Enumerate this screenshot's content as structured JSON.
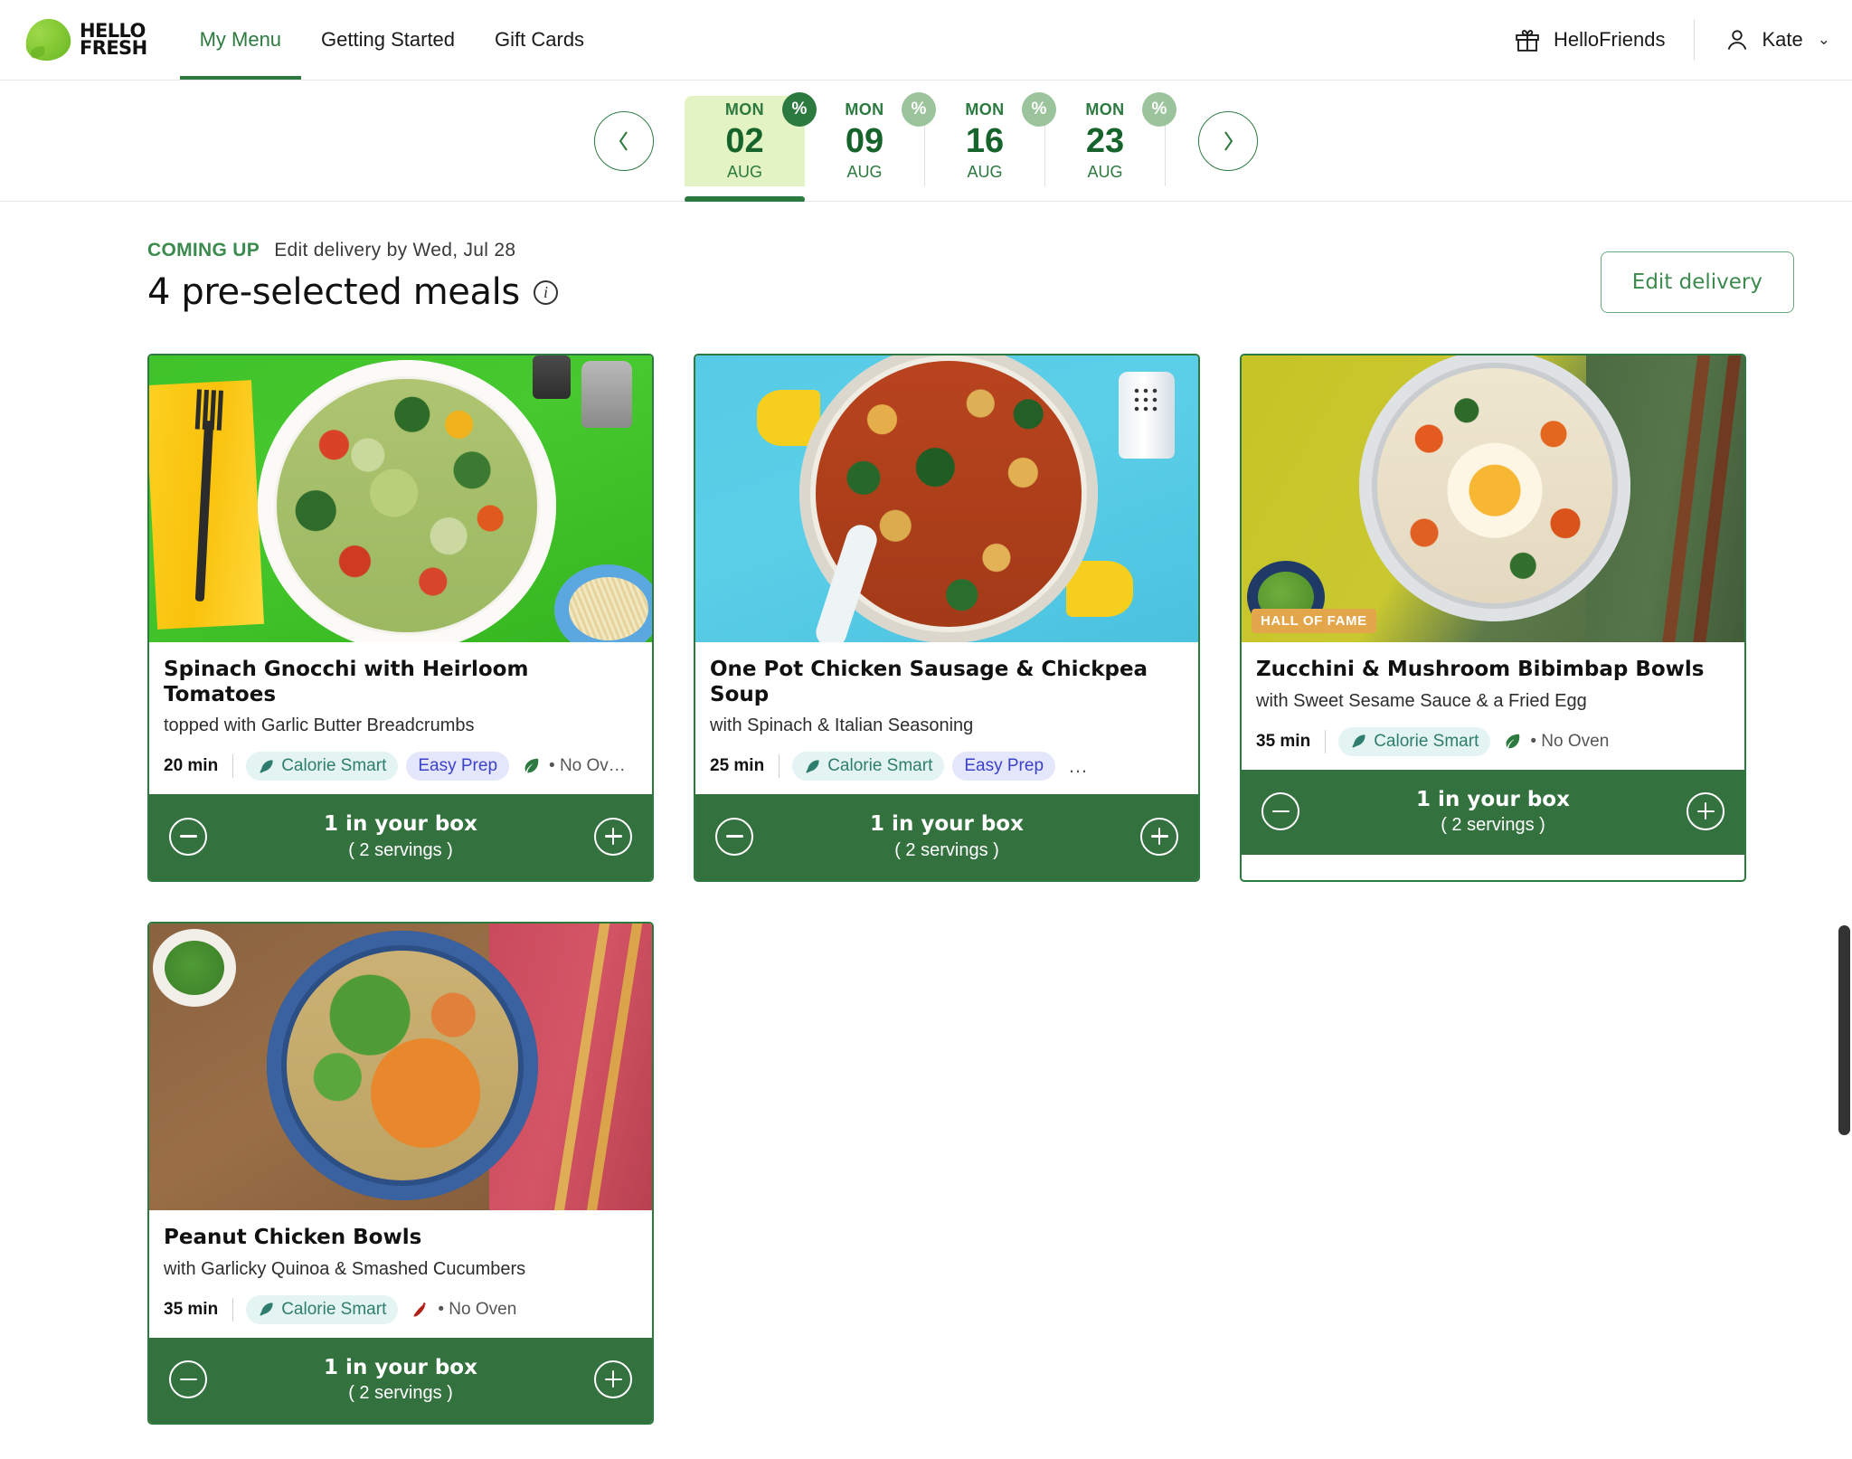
{
  "header": {
    "logo_line1": "HELLO",
    "logo_line2": "FRESH",
    "logo_icon": "leaf-logo-icon",
    "nav": [
      {
        "label": "My Menu",
        "active": true
      },
      {
        "label": "Getting Started",
        "active": false
      },
      {
        "label": "Gift Cards",
        "active": false
      }
    ],
    "referral_label": "HelloFriends",
    "referral_icon": "gift-icon",
    "account_label": "Kate",
    "account_icon": "person-icon",
    "account_chevron": "chevron-down-icon"
  },
  "date_strip": {
    "prev_icon": "chevron-left-icon",
    "next_icon": "chevron-right-icon",
    "discount_badge": "%",
    "dates": [
      {
        "dow": "MON",
        "day": "02",
        "month": "AUG",
        "selected": true
      },
      {
        "dow": "MON",
        "day": "09",
        "month": "AUG",
        "selected": false
      },
      {
        "dow": "MON",
        "day": "16",
        "month": "AUG",
        "selected": false
      },
      {
        "dow": "MON",
        "day": "23",
        "month": "AUG",
        "selected": false
      }
    ]
  },
  "section": {
    "kicker_label": "COMING UP",
    "kicker_detail": "Edit delivery by Wed, Jul 28",
    "title": "4 pre-selected meals",
    "info_icon": "info-icon",
    "edit_delivery_label": "Edit delivery"
  },
  "meals": [
    {
      "title": "Spinach Gnocchi with Heirloom Tomatoes",
      "subtitle": "topped with Garlic Butter Breadcrumbs",
      "time": "20 min",
      "tags": [
        {
          "label": "Calorie Smart",
          "style": "calorie",
          "icon": "feather-icon"
        },
        {
          "label": "Easy Prep",
          "style": "easyprep",
          "icon": ""
        }
      ],
      "extra_icon": "leaf-icon",
      "extra_text": "• No Ov…",
      "show_ellipsis": false,
      "badge": "",
      "box_count": "1 in your box",
      "servings": "( 2 servings )",
      "minus_icon": "minus-circle-icon",
      "plus_icon": "plus-circle-icon"
    },
    {
      "title": "One Pot Chicken Sausage & Chickpea Soup",
      "subtitle": "with Spinach & Italian Seasoning",
      "time": "25 min",
      "tags": [
        {
          "label": "Calorie Smart",
          "style": "calorie",
          "icon": "feather-icon"
        },
        {
          "label": "Easy Prep",
          "style": "easyprep",
          "icon": ""
        }
      ],
      "extra_icon": "",
      "extra_text": "",
      "show_ellipsis": true,
      "ellipsis": "…",
      "badge": "",
      "box_count": "1 in your box",
      "servings": "( 2 servings )",
      "minus_icon": "minus-circle-icon",
      "plus_icon": "plus-circle-icon"
    },
    {
      "title": "Zucchini & Mushroom Bibimbap Bowls",
      "subtitle": "with Sweet Sesame Sauce & a Fried Egg",
      "time": "35 min",
      "tags": [
        {
          "label": "Calorie Smart",
          "style": "calorie",
          "icon": "feather-icon"
        }
      ],
      "extra_icon": "leaf-icon",
      "extra_text": "• No Oven",
      "show_ellipsis": false,
      "badge": "HALL OF FAME",
      "box_count": "1 in your box",
      "servings": "( 2 servings )",
      "minus_icon": "minus-circle-icon",
      "plus_icon": "plus-circle-icon"
    },
    {
      "title": "Peanut Chicken Bowls",
      "subtitle": "with Garlicky Quinoa & Smashed Cucumbers",
      "time": "35 min",
      "tags": [
        {
          "label": "Calorie Smart",
          "style": "calorie",
          "icon": "feather-icon"
        }
      ],
      "extra_icon": "chili-icon",
      "extra_text": "• No Oven",
      "show_ellipsis": false,
      "badge": "",
      "box_count": "1 in your box",
      "servings": "( 2 servings )",
      "minus_icon": "minus-circle-icon",
      "plus_icon": "plus-circle-icon"
    }
  ],
  "colors": {
    "brand_green": "#2c7a3f",
    "footer_green": "#33713f",
    "selected_date_bg": "#e4f3c3",
    "hall_of_fame": "#e3a64b",
    "calorie_tag_bg": "#e3f4f3",
    "calorie_tag_fg": "#2f7d6e",
    "easyprep_tag_bg": "#e4e6fb",
    "easyprep_tag_fg": "#3c41c9"
  },
  "scrollbar": {
    "name": "vertical-scrollbar"
  }
}
